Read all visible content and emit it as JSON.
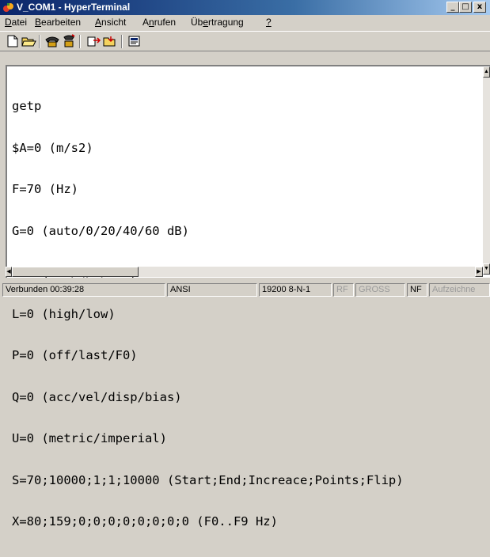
{
  "window": {
    "title": "V_COM1 - HyperTerminal",
    "min_glyph": "_",
    "max_glyph": "□",
    "close_glyph": "x"
  },
  "menu": [
    {
      "pre": "",
      "key": "D",
      "post": "atei"
    },
    {
      "pre": "",
      "key": "B",
      "post": "earbeiten"
    },
    {
      "pre": "",
      "key": "A",
      "post": "nsicht"
    },
    {
      "pre": "A",
      "key": "n",
      "post": "rufen"
    },
    {
      "pre": "Üb",
      "key": "e",
      "post": "rtragung"
    },
    {
      "pre": "",
      "key": "?",
      "post": ""
    }
  ],
  "toolbar": {
    "icons": [
      "new-document-icon",
      "open-folder-icon",
      "call-phone-icon",
      "disconnect-phone-icon",
      "send-file-icon",
      "receive-file-icon",
      "properties-icon"
    ]
  },
  "terminal": {
    "lines": [
      "getp",
      "$A=0 (m/s2)",
      "F=70 (Hz)",
      "G=0 (auto/0/20/40/60 dB)",
      "I=2 (off/Q/U/ICP)",
      "L=0 (high/low)",
      "P=0 (off/last/F0)",
      "Q=0 (acc/vel/disp/bias)",
      "U=0 (metric/imperial)",
      "S=70;10000;1;1;10000 (Start;End;Increace;Points;Flip)",
      "X=80;159;0;0;0;0;0;0;0;0 (F0..F9 Hz)"
    ]
  },
  "status": {
    "connected": "Verbunden 00:39:28",
    "emulation": "ANSI",
    "port_settings": "19200 8-N-1",
    "rf": "RF",
    "gross": "GROSS",
    "nf": "NF",
    "capture": "Aufzeichne"
  },
  "colors": {
    "titlebar_start": "#0a246a",
    "titlebar_end": "#a6caf0",
    "chrome": "#d4d0c8",
    "terminal_bg": "#ffffff"
  }
}
